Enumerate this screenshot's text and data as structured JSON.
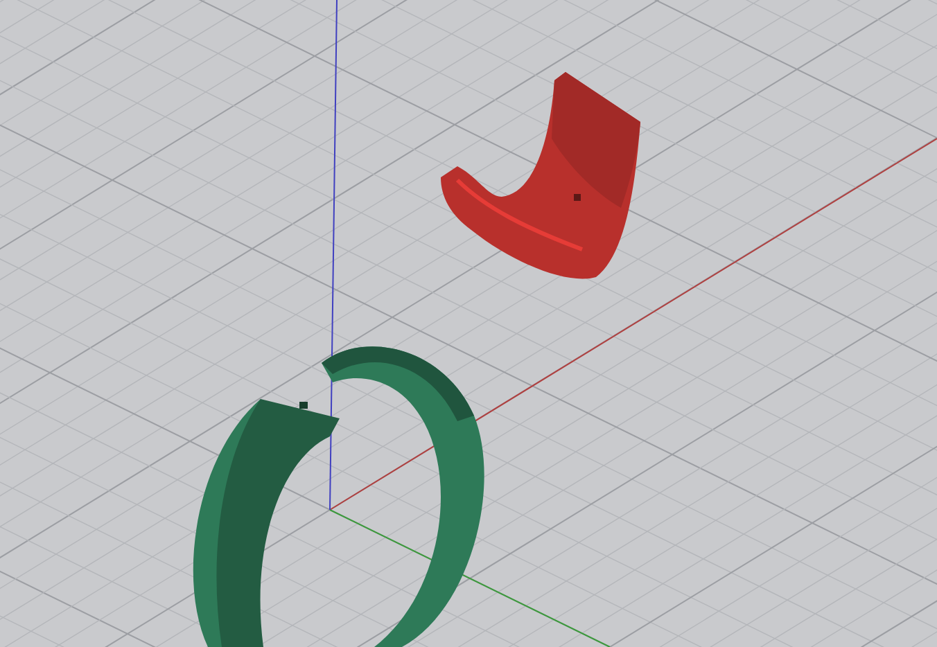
{
  "viewport": {
    "objects": [
      {
        "kind": "clip",
        "color": "#b8302c"
      },
      {
        "kind": "ring",
        "color": "#2e7a58"
      }
    ]
  }
}
